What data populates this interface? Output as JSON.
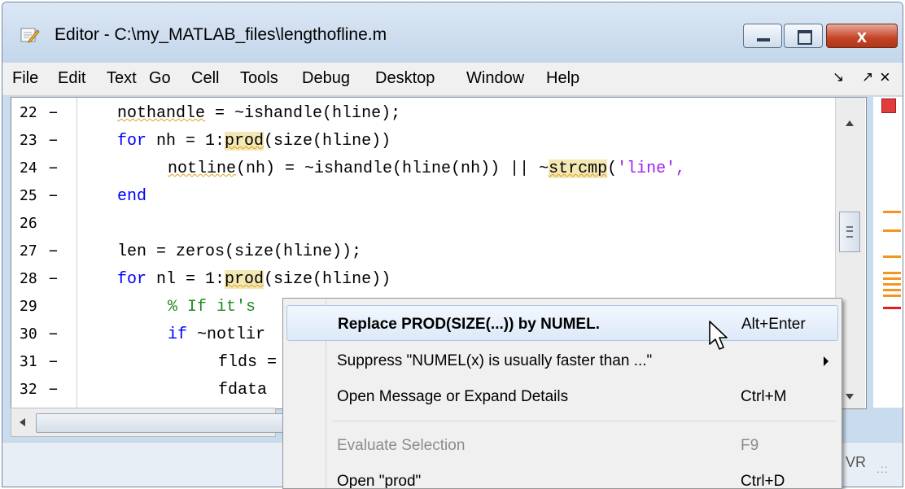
{
  "window": {
    "title": "Editor - C:\\my_MATLAB_files\\lengthofline.m",
    "buttons": {
      "minimize": "minimize",
      "maximize": "maximize",
      "close": "x"
    }
  },
  "menu": {
    "items": [
      "File",
      "Edit",
      "Text",
      "Go",
      "Cell",
      "Tools",
      "Debug",
      "Desktop",
      "Window",
      "Help"
    ],
    "dock": "↘",
    "undock": "↗",
    "close": "×"
  },
  "editor": {
    "lines": [
      {
        "num": "22",
        "dash": "−"
      },
      {
        "num": "23",
        "dash": "−"
      },
      {
        "num": "24",
        "dash": "−"
      },
      {
        "num": "25",
        "dash": "−"
      },
      {
        "num": "26",
        "dash": ""
      },
      {
        "num": "27",
        "dash": "−"
      },
      {
        "num": "28",
        "dash": "−"
      },
      {
        "num": "29",
        "dash": ""
      },
      {
        "num": "30",
        "dash": "−"
      },
      {
        "num": "31",
        "dash": "−"
      },
      {
        "num": "32",
        "dash": "−"
      }
    ],
    "code": {
      "l22": {
        "a": "nothandle",
        "b": " = ~ishandle(hline);"
      },
      "l23": {
        "kw": "for",
        "a": " nh = 1:",
        "hl": "prod",
        "b": "(size(hline))"
      },
      "l24": {
        "a": "notline",
        "b": "(nh) = ~ishandle(hline(nh)) || ~",
        "hl": "strcmp",
        "c": "(",
        "str": "'line',"
      },
      "l25": {
        "kw": "end"
      },
      "l27": {
        "a": "len = zeros(size(hline));"
      },
      "l28": {
        "kw": "for",
        "a": " nl = 1:",
        "hl": "prod",
        "b": "(size(hline))"
      },
      "l29": {
        "cmt": "% If it's"
      },
      "l30": {
        "kw": "if",
        "a": " ~notlir"
      },
      "l31": {
        "a": "flds ="
      },
      "l32": {
        "a": "fdata"
      }
    },
    "marker_colors": {
      "warning": "#f7941d",
      "error": "#e02020"
    }
  },
  "status": {
    "mode": "VR",
    "grip": ".::"
  },
  "context_menu": {
    "items": [
      {
        "label": "Replace PROD(SIZE(...)) by NUMEL.",
        "shortcut": "Alt+Enter"
      },
      {
        "label": "Suppress \"NUMEL(x) is usually faster than ...\"",
        "shortcut": ""
      },
      {
        "label": "Open Message or Expand Details",
        "shortcut": "Ctrl+M"
      },
      {
        "label": "Evaluate Selection",
        "shortcut": "F9"
      },
      {
        "label": "Open \"prod\"",
        "shortcut": "Ctrl+D"
      }
    ]
  }
}
